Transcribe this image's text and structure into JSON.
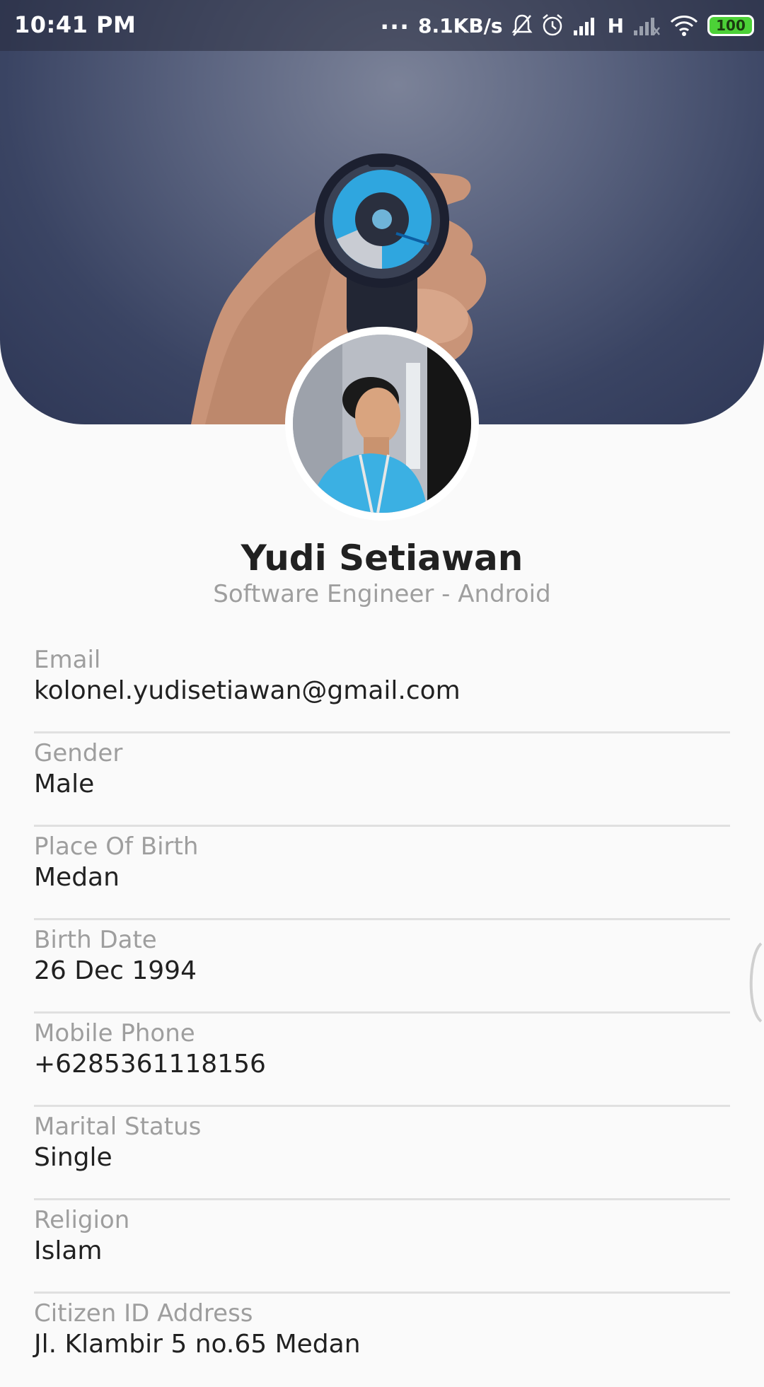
{
  "status_bar": {
    "time": "10:41 PM",
    "dots": "...",
    "network_speed": "8.1KB/s",
    "network_type": "H",
    "battery": "100",
    "icons": [
      "bell-off-icon",
      "alarm-icon",
      "signal-icon",
      "signal-weak-icon",
      "wifi-icon",
      "battery-icon"
    ]
  },
  "profile": {
    "name": "Yudi Setiawan",
    "title": "Software Engineer - Android"
  },
  "details": [
    {
      "label": "Email",
      "value": "kolonel.yudisetiawan@gmail.com"
    },
    {
      "label": "Gender",
      "value": "Male"
    },
    {
      "label": "Place Of Birth",
      "value": "Medan"
    },
    {
      "label": "Birth Date",
      "value": "26 Dec 1994"
    },
    {
      "label": "Mobile Phone",
      "value": "+6285361118156"
    },
    {
      "label": "Marital Status",
      "value": "Single"
    },
    {
      "label": "Religion",
      "value": "Islam"
    },
    {
      "label": "Citizen ID Address",
      "value": "Jl. Klambir 5 no.65 Medan"
    }
  ],
  "colors": {
    "background": "#fafafa",
    "cover_dark": "#2e3756",
    "label_gray": "#9e9e9e",
    "text_dark": "#212121",
    "divider": "#e0e0e0",
    "battery_green": "#4cd137"
  }
}
